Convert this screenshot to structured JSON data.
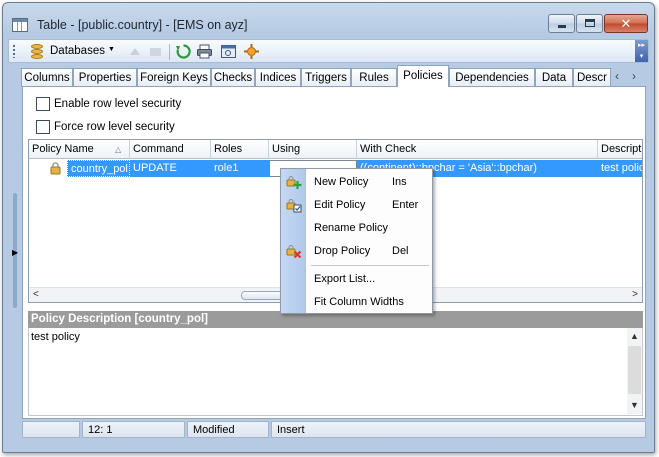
{
  "window": {
    "title": "Table - [public.country] - [EMS on ayz]"
  },
  "toolbar": {
    "databases_label": "Databases"
  },
  "tabs": [
    {
      "label": "Columns"
    },
    {
      "label": "Properties"
    },
    {
      "label": "Foreign Keys"
    },
    {
      "label": "Checks"
    },
    {
      "label": "Indices"
    },
    {
      "label": "Triggers"
    },
    {
      "label": "Rules"
    },
    {
      "label": "Policies"
    },
    {
      "label": "Dependencies"
    },
    {
      "label": "Data"
    },
    {
      "label": "Descr"
    }
  ],
  "active_tab": "Policies",
  "options": {
    "enable_rls": "Enable row level security",
    "force_rls": "Force row level security"
  },
  "grid": {
    "columns": [
      "Policy Name",
      "Command",
      "Roles",
      "Using",
      "With Check",
      "Descript"
    ],
    "rows": [
      {
        "policy_name": "country_pol",
        "command": "UPDATE",
        "roles": "role1",
        "using": "",
        "with_check": "((continent)::bpchar = 'Asia'::bpchar)",
        "description": "test polic"
      }
    ]
  },
  "description_panel": {
    "header": "Policy Description [country_pol]",
    "text": "test policy"
  },
  "statusbar": {
    "position": "12:   1",
    "state": "Modified",
    "mode": "Insert"
  },
  "context_menu": {
    "items": [
      {
        "label": "New Policy",
        "shortcut": "Ins",
        "icon": "new-policy-icon"
      },
      {
        "label": "Edit Policy",
        "shortcut": "Enter",
        "icon": "edit-policy-icon"
      },
      {
        "label": "Rename Policy",
        "shortcut": "",
        "icon": ""
      },
      {
        "label": "Drop Policy",
        "shortcut": "Del",
        "icon": "drop-policy-icon"
      },
      {
        "label": "Export List...",
        "shortcut": "",
        "icon": ""
      },
      {
        "label": "Fit Column Widths",
        "shortcut": "",
        "icon": ""
      }
    ]
  },
  "colors": {
    "selection": "#3399ff",
    "description_header": "#9b9b9b"
  }
}
